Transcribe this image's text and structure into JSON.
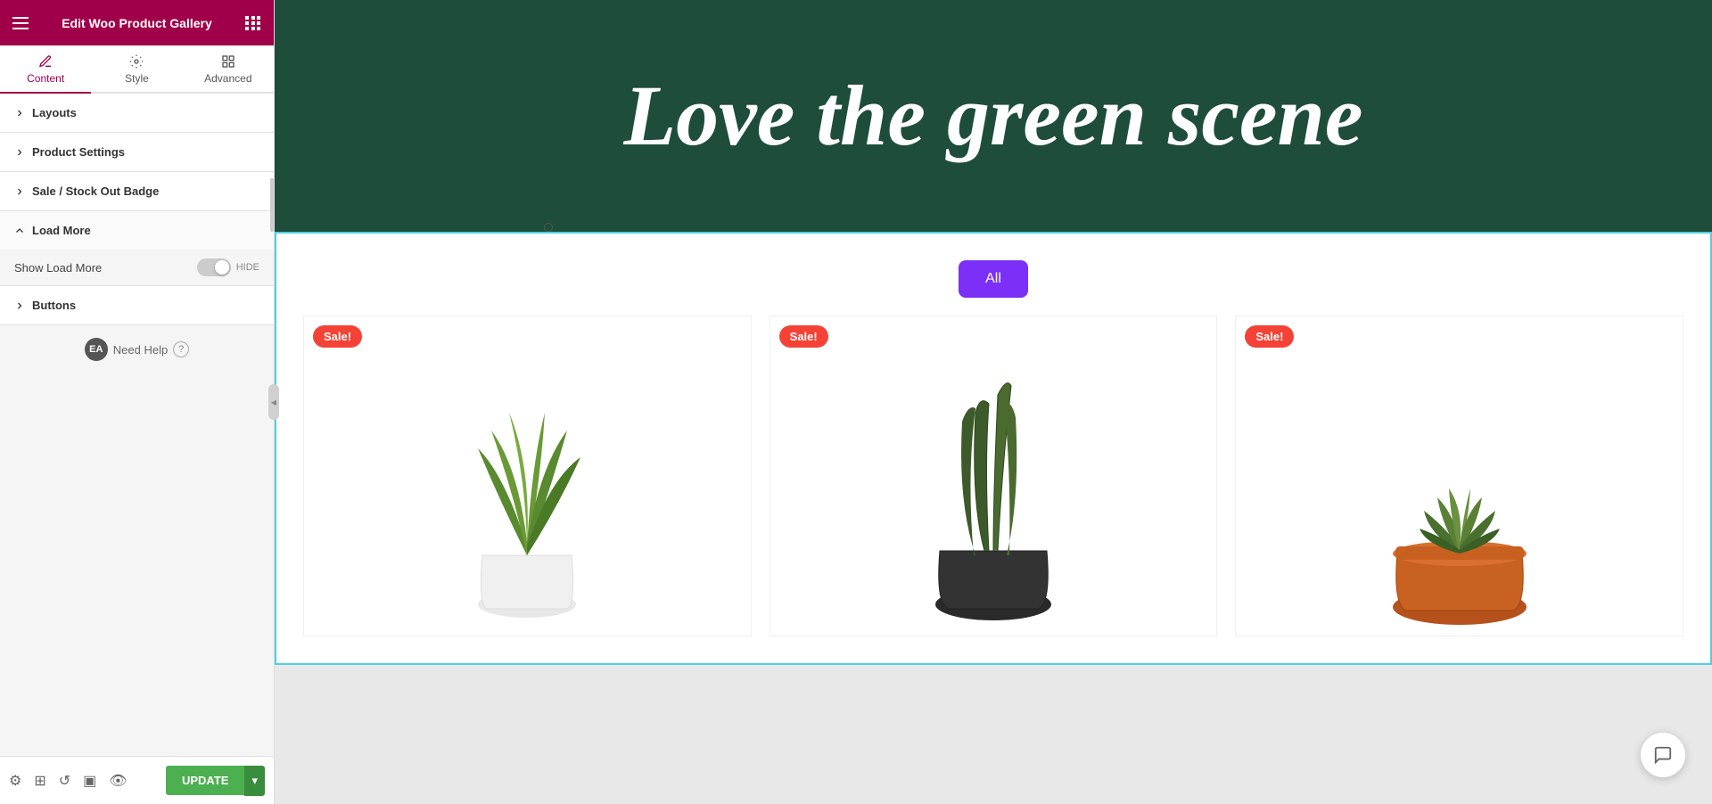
{
  "header": {
    "title": "Edit Woo Product Gallery",
    "menu_icon": "menu-icon",
    "grid_icon": "grid-icon"
  },
  "tabs": [
    {
      "id": "content",
      "label": "Content",
      "active": true
    },
    {
      "id": "style",
      "label": "Style",
      "active": false
    },
    {
      "id": "advanced",
      "label": "Advanced",
      "active": false
    }
  ],
  "accordion": [
    {
      "id": "layouts",
      "label": "Layouts",
      "open": false
    },
    {
      "id": "product_settings",
      "label": "Product Settings",
      "open": false
    },
    {
      "id": "sale_badge",
      "label": "Sale / Stock Out Badge",
      "open": false
    },
    {
      "id": "load_more",
      "label": "Load More",
      "open": true
    },
    {
      "id": "buttons",
      "label": "Buttons",
      "open": false
    }
  ],
  "load_more": {
    "show_label": "Show Load More",
    "toggle_state": "HIDE"
  },
  "need_help": {
    "label": "Need Help",
    "logo_text": "EA"
  },
  "toolbar": {
    "update_label": "UPDATE"
  },
  "canvas": {
    "hero_title": "Love the green scene",
    "filter_button": "All",
    "products": [
      {
        "id": 1,
        "sale": true,
        "sale_label": "Sale!",
        "plant_type": "aloe"
      },
      {
        "id": 2,
        "sale": true,
        "sale_label": "Sale!",
        "plant_type": "snake"
      },
      {
        "id": 3,
        "sale": true,
        "sale_label": "Sale!",
        "plant_type": "haworthia"
      }
    ]
  },
  "colors": {
    "accent": "#a0004a",
    "green_btn": "#4caf50",
    "green_btn_dark": "#388e3c",
    "filter_purple": "#7b2ff7",
    "hero_bg": "#1e4d3b",
    "sale_red": "#f44336",
    "canvas_border": "#4dd0e1"
  }
}
